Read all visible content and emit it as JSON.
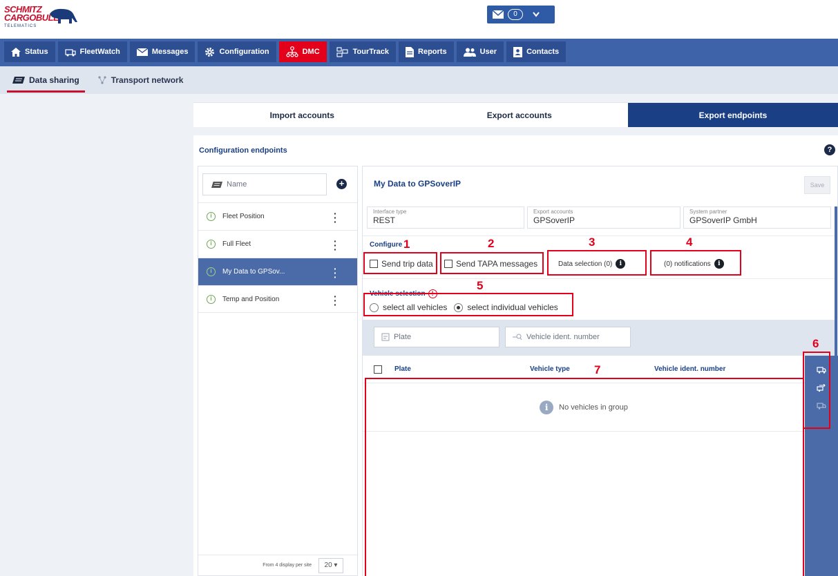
{
  "brand": {
    "line1": "SCHMITZ",
    "line2": "CARGOBULL",
    "line3": "TELEMATICS",
    "red": "#c8102e",
    "navy": "#1a3f85"
  },
  "header": {
    "message_count": "0"
  },
  "nav": {
    "tabs": [
      {
        "label": "Status",
        "icon": "home-icon"
      },
      {
        "label": "FleetWatch",
        "icon": "fleetwatch-icon"
      },
      {
        "label": "Messages",
        "icon": "envelope-icon"
      },
      {
        "label": "Configuration",
        "icon": "gear-icon"
      },
      {
        "label": "DMC",
        "icon": "network-icon",
        "active": true
      },
      {
        "label": "TourTrack",
        "icon": "tourtrack-icon"
      },
      {
        "label": "Reports",
        "icon": "report-icon"
      },
      {
        "label": "User",
        "icon": "users-icon"
      },
      {
        "label": "Contacts",
        "icon": "contacts-icon"
      }
    ]
  },
  "subnav": {
    "items": [
      {
        "label": "Data sharing",
        "active": true
      },
      {
        "label": "Transport network"
      }
    ]
  },
  "toptabs": {
    "items": [
      {
        "label": "Import accounts"
      },
      {
        "label": "Export accounts"
      },
      {
        "label": "Export endpoints",
        "active": true
      }
    ]
  },
  "panel": {
    "title": "Configuration endpoints",
    "help": "?"
  },
  "list": {
    "search_placeholder": "Name",
    "items": [
      {
        "label": "Fleet Position"
      },
      {
        "label": "Full Fleet"
      },
      {
        "label": "My Data to GPSov...",
        "active": true
      },
      {
        "label": "Temp and Position"
      }
    ],
    "pager_text": "From 4 display per site",
    "page_size": "20 ▾"
  },
  "detail": {
    "title": "My Data to GPSoverIP",
    "save_label": "Save",
    "fields": [
      {
        "label": "Interface type",
        "value": "REST"
      },
      {
        "label": "Export accounts",
        "value": "GPSoverIP"
      },
      {
        "label": "System partner",
        "value": "GPSoverIP GmbH"
      }
    ],
    "configure_label": "Configure",
    "send_trip_data": "Send trip data",
    "send_tapa": "Send TAPA messages",
    "data_selection": "Data selection (0)",
    "notifications": "(0) notifications",
    "vehicle_selection_label": "Vehicle selection",
    "radio_all": "select all vehicles",
    "radio_individual": "select individual vehicles",
    "filter_plate": "Plate",
    "filter_vin": "Vehicle ident. number",
    "col_plate": "Plate",
    "col_type": "Vehicle type",
    "col_vin": "Vehicle ident. number",
    "empty_text": "No vehicles in group"
  },
  "annotations": {
    "n1": "1",
    "n2": "2",
    "n3": "3",
    "n4": "4",
    "n5": "5",
    "n6": "6",
    "n7": "7",
    "color": "#e3001b"
  }
}
